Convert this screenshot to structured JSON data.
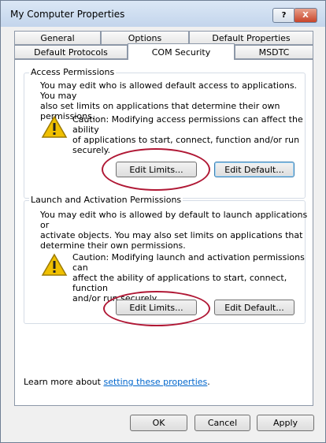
{
  "window": {
    "title": "My Computer Properties"
  },
  "titlebar": {
    "help_label": "?",
    "close_label": "X"
  },
  "tabs": {
    "row1": [
      "General",
      "Options",
      "Default Properties"
    ],
    "row2": [
      "Default Protocols",
      "COM Security",
      "MSDTC"
    ],
    "active": "COM Security"
  },
  "access": {
    "title": "Access Permissions",
    "desc_lines": [
      "You may edit who is allowed default access to applications. You may",
      "also set limits on applications that determine their own permissions."
    ],
    "caution_lines": [
      "Caution: Modifying access permissions can affect the ability",
      "of applications to start, connect, function and/or run",
      "securely."
    ],
    "edit_limits": "Edit Limits...",
    "edit_default": "Edit Default..."
  },
  "launch": {
    "title": "Launch and Activation Permissions",
    "desc_lines": [
      "You may edit who is allowed by default to launch applications or",
      "activate objects. You may also set limits on applications that",
      "determine their own permissions."
    ],
    "caution_lines": [
      "Caution: Modifying launch and activation permissions can",
      "affect the ability of applications to start, connect, function",
      "and/or run securely."
    ],
    "edit_limits": "Edit Limits...",
    "edit_default": "Edit Default..."
  },
  "footer": {
    "learn_prefix": "Learn more about",
    "learn_link": "setting these properties",
    "learn_suffix": "."
  },
  "buttons": {
    "ok": "OK",
    "cancel": "Cancel",
    "apply": "Apply"
  },
  "colors": {
    "highlight_ring": "#b01835",
    "link": "#0066cc",
    "warning": "#f0c000"
  }
}
